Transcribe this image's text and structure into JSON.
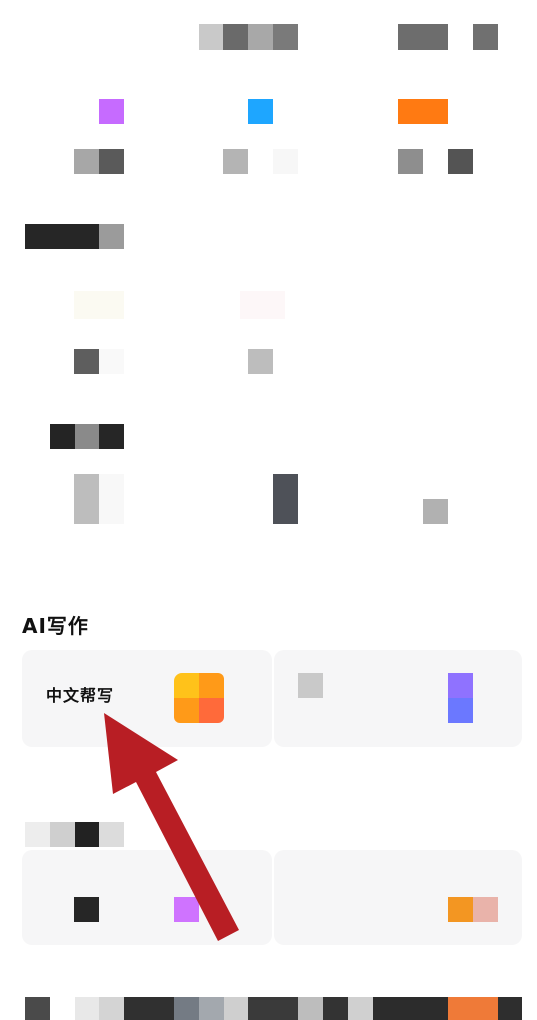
{
  "section": {
    "title": "AI写作"
  },
  "cards": [
    {
      "label": "中文帮写"
    }
  ],
  "colors": {
    "arrow": "#b81e24",
    "card_bg": "#f6f6f7",
    "icon_yellow": "#ffc21a",
    "icon_orange": "#ff8a1f",
    "icon_red": "#ff5a3a",
    "purple": "#c66bff",
    "blue": "#1ea6ff",
    "orange": "#ff7a12"
  }
}
